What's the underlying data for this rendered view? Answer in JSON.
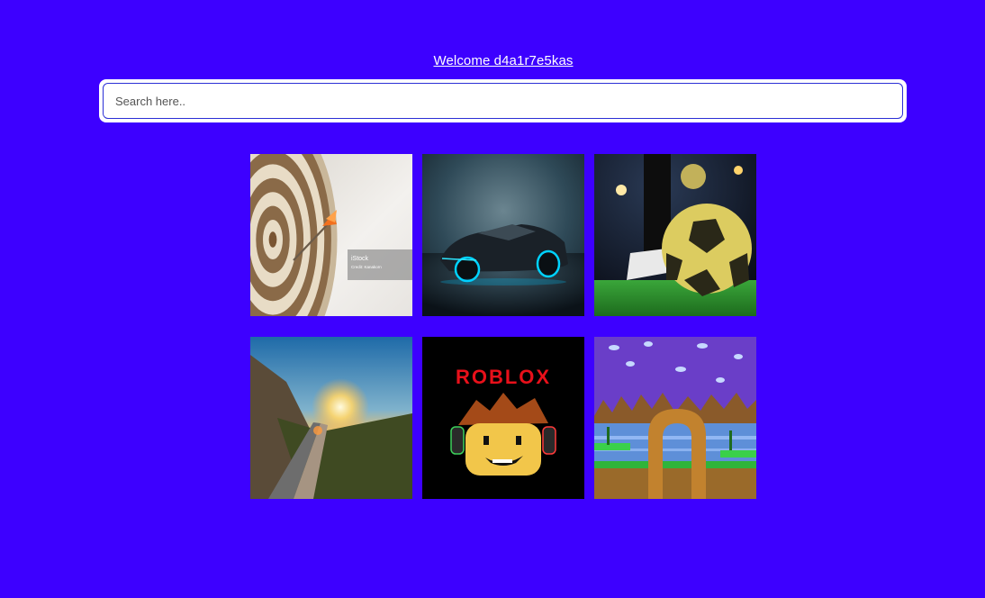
{
  "header": {
    "welcome_text": "Welcome d4a1r7e5kas"
  },
  "search": {
    "placeholder": "Search here..",
    "value": ""
  },
  "gallery": {
    "items": [
      {
        "name": "dartboard-tile",
        "caption": "iStock",
        "caption_sub": "Credit: Kanakorn"
      },
      {
        "name": "sports-car-tile"
      },
      {
        "name": "soccer-ball-tile"
      },
      {
        "name": "sunset-road-tile"
      },
      {
        "name": "roblox-tile",
        "logo_text": "ROBLOX"
      },
      {
        "name": "green-hill-zone-tile"
      }
    ]
  },
  "colors": {
    "background": "#3d00ff",
    "input_border": "#2b2fd6",
    "roblox_red": "#e8101a"
  }
}
